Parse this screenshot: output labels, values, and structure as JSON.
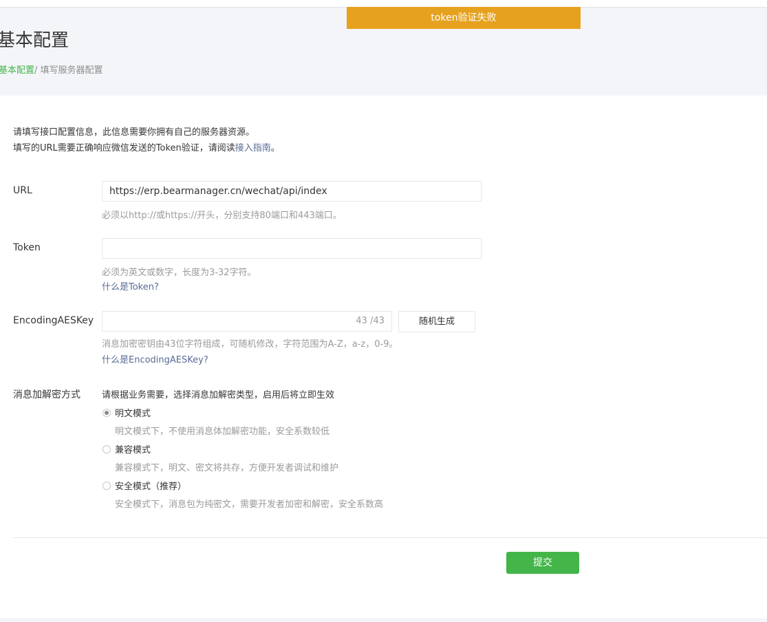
{
  "toast": {
    "text": "token验证失败"
  },
  "header": {
    "title": "基本配置",
    "breadcrumb": {
      "link": "基本配置",
      "separator": "/ ",
      "current": "填写服务器配置"
    }
  },
  "intro": {
    "line1": "请填写接口配置信息，此信息需要你拥有自己的服务器资源。",
    "line2_prefix": "填写的URL需要正确响应微信发送的Token验证，请阅读",
    "line2_link": "接入指南",
    "line2_suffix": "。"
  },
  "url": {
    "label": "URL",
    "value": "https://erp.bearmanager.cn/wechat/api/index",
    "tip": "必须以http://或https://开头，分别支持80端口和443端口。"
  },
  "token": {
    "label": "Token",
    "value": "",
    "tip": "必须为英文或数字，长度为3-32字符。",
    "help_link": "什么是Token?"
  },
  "aes": {
    "label": "EncodingAESKey",
    "value": "",
    "counter": "43 /43",
    "generate_button": "随机生成",
    "tip": "消息加密密钥由43位字符组成，可随机修改，字符范围为A-Z，a-z，0-9。",
    "help_link": "什么是EncodingAESKey?"
  },
  "encryption": {
    "label": "消息加解密方式",
    "hint": "请根据业务需要，选择消息加解密类型，启用后将立即生效",
    "options": [
      {
        "label": "明文模式",
        "desc": "明文模式下，不使用消息体加解密功能，安全系数较低",
        "checked": true
      },
      {
        "label": "兼容模式",
        "desc": "兼容模式下，明文、密文将共存，方便开发者调试和维护",
        "checked": false
      },
      {
        "label": "安全模式（推荐）",
        "desc": "安全模式下，消息包为纯密文，需要开发者加密和解密，安全系数高",
        "checked": false
      }
    ]
  },
  "submit_label": "提交",
  "colors": {
    "accent": "#44b549",
    "toast": "#e6a11f",
    "link": "#576b95"
  }
}
